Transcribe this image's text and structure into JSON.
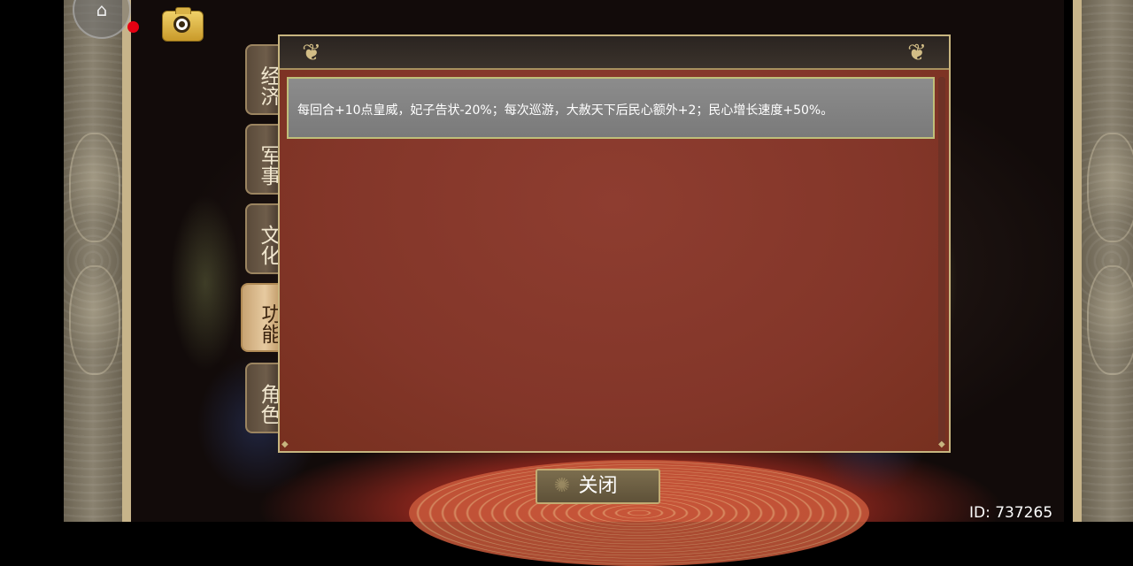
{
  "tabs": [
    {
      "label": "经济",
      "active": false
    },
    {
      "label": "军事",
      "active": false
    },
    {
      "label": "文化",
      "active": false
    },
    {
      "label": "功能",
      "active": true
    },
    {
      "label": "角色",
      "active": false
    }
  ],
  "dialog": {
    "items": [
      {
        "text": "每回合+10点皇威，妃子告状-20%；每次巡游，大赦天下后民心额外+2；民心增长速度+50%。"
      }
    ]
  },
  "close_button": {
    "label": "关闭"
  },
  "footer": {
    "id_text": "ID: 737265"
  },
  "icons": {
    "assistive": "assistive-touch-icon",
    "camera": "camera-icon",
    "record": "record-indicator-icon"
  },
  "colors": {
    "dialog_bg": "#8e3d30",
    "item_bg": "#8c8c8c",
    "gold_border": "#c7b57f",
    "record_dot": "#e60012"
  }
}
